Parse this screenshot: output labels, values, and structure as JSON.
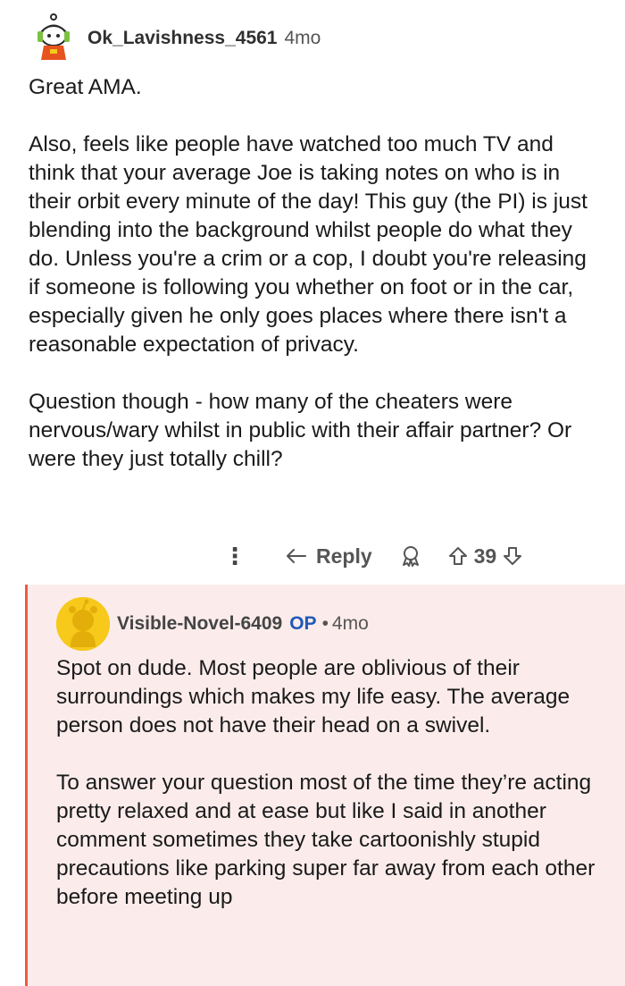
{
  "comment": {
    "username": "Ok_Lavishness_4561",
    "age": "4mo",
    "paragraphs": [
      "Great AMA.",
      "Also, feels like people have watched too much TV and think that your average Joe is taking notes on who is in their orbit every minute of the day! This guy (the PI) is just blending into the background whilst people do what they do. Unless you're a crim or a cop, I doubt you're releasing if someone is following you whether on foot or in the car, especially given he only goes places where there isn't a reasonable expectation of privacy.",
      "Question though - how many of the cheaters were nervous/wary whilst in public with their affair partner? Or were they just totally chill?"
    ],
    "actions": {
      "more_icon": "more-vertical-icon",
      "reply_label": "Reply",
      "award_icon": "award-icon",
      "vote_count": "39"
    }
  },
  "reply": {
    "username": "Visible-Novel-6409",
    "op_label": "OP",
    "separator": "•",
    "age": "4mo",
    "paragraphs": [
      "Spot on dude. Most people are oblivious of their surroundings which makes my life easy. The average person does not have their head on a swivel.",
      "To answer your question most of the time they’re acting pretty relaxed and at ease but like I said in another comment sometimes they take cartoonishly stupid precautions like parking super far away from each other before meeting up"
    ]
  },
  "colors": {
    "reply_background": "#fbeceb",
    "thread_line": "#f05a3f",
    "op_badge": "#1f59b6",
    "avatar_2": "#f6c91b"
  }
}
